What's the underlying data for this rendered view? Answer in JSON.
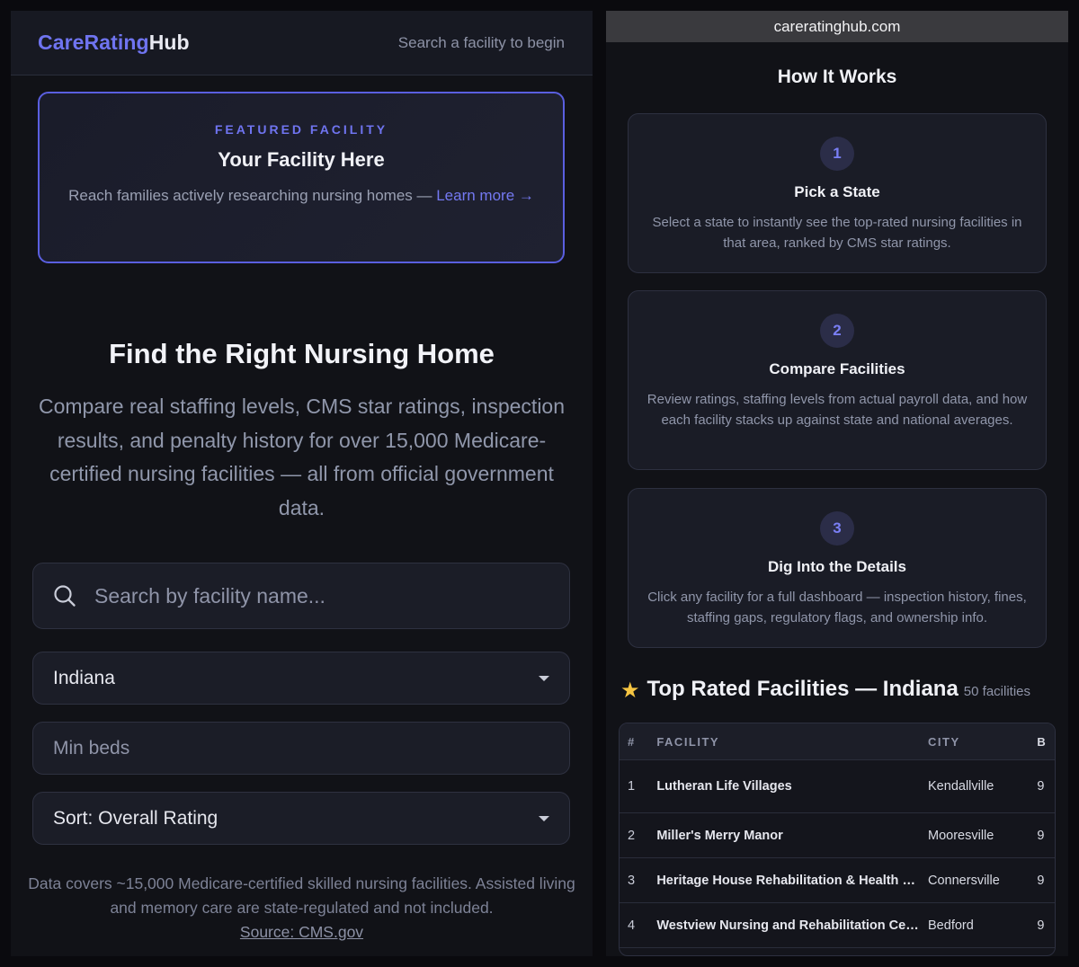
{
  "left": {
    "logo": {
      "part1": "CareRating",
      "part2": "Hub"
    },
    "topbar_hint": "Search a facility to begin",
    "featured": {
      "kicker": "FEATURED FACILITY",
      "title": "Your Facility Here",
      "description": "Reach families actively researching nursing homes — ",
      "link": "Learn more →"
    },
    "hero": {
      "title": "Find the Right Nursing Home",
      "subtitle": "Compare real staffing levels, CMS star ratings, inspection results, and penalty history for over 15,000 Medicare-certified nursing facilities — all from official government data."
    },
    "search": {
      "placeholder": "Search by facility name..."
    },
    "state_select": {
      "value": "Indiana"
    },
    "min_beds": {
      "placeholder": "Min beds"
    },
    "sort_select": {
      "value": "Sort: Overall Rating"
    },
    "footnote": {
      "text": "Data covers ~15,000 Medicare-certified skilled nursing facilities. Assisted living and memory care are state-regulated and not included.",
      "source_link": "Source: CMS.gov"
    }
  },
  "right": {
    "url": "careratinghub.com",
    "how_title": "How It Works",
    "steps": [
      {
        "num": "1",
        "title": "Pick a State",
        "desc": "Select a state to instantly see the top-rated nursing facilities in that area, ranked by CMS star ratings."
      },
      {
        "num": "2",
        "title": "Compare Facilities",
        "desc": "Review ratings, staffing levels from actual payroll data, and how each facility stacks up against state and national averages."
      },
      {
        "num": "3",
        "title": "Dig Into the Details",
        "desc": "Click any facility for a full dashboard — inspection history, fines, staffing gaps, regulatory flags, and ownership info."
      }
    ],
    "top_rated": {
      "title": "Top Rated Facilities — Indiana",
      "count": "50 facilities",
      "columns": [
        "#",
        "FACILITY",
        "CITY",
        "B"
      ],
      "rows": [
        {
          "num": "1",
          "facility": "Lutheran Life Villages",
          "city": "Kendallville",
          "beds": "9"
        },
        {
          "num": "2",
          "facility": "Miller's Merry Manor",
          "city": "Mooresville",
          "beds": "9"
        },
        {
          "num": "3",
          "facility": "Heritage House Rehabilitation & Health Center",
          "city": "Connersville",
          "beds": "9"
        },
        {
          "num": "4",
          "facility": "Westview Nursing and Rehabilitation Center",
          "city": "Bedford",
          "beds": "9"
        }
      ]
    }
  },
  "colors": {
    "accent": "#6f74f0",
    "background": "#111217",
    "card": "#1a1c26"
  }
}
